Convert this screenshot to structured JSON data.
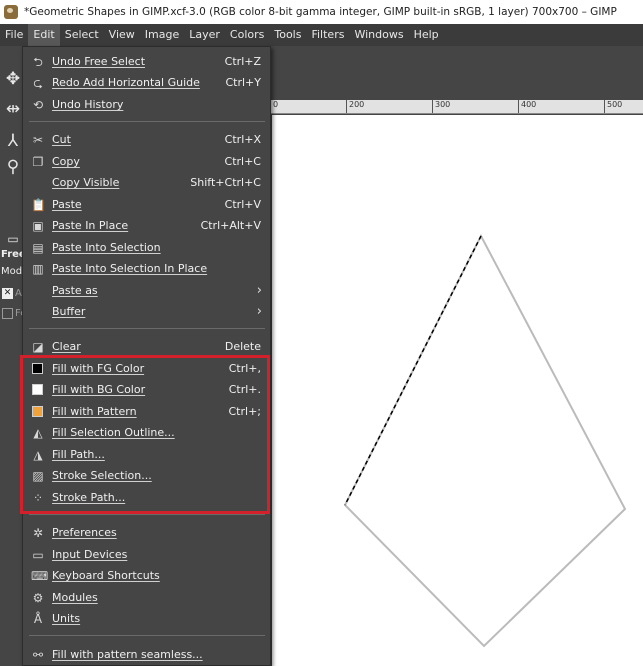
{
  "window": {
    "title": "*Geometric Shapes in GIMP.xcf-3.0 (RGB color 8-bit gamma integer, GIMP built-in sRGB, 1 layer) 700x700 – GIMP"
  },
  "menubar": [
    "File",
    "Edit",
    "Select",
    "View",
    "Image",
    "Layer",
    "Colors",
    "Tools",
    "Filters",
    "Windows",
    "Help"
  ],
  "tool_options": {
    "label_free": "Free",
    "label_mode": "Mode",
    "label_a": "A",
    "label_fe": "Fe"
  },
  "ruler_ticks": [
    "0",
    "200",
    "300",
    "400",
    "500"
  ],
  "edit_menu": {
    "undo": {
      "label": "Undo Free Select",
      "accel": "Ctrl+Z",
      "icon": "undo-icon"
    },
    "redo": {
      "label": "Redo Add Horizontal Guide",
      "accel": "Ctrl+Y",
      "icon": "redo-icon"
    },
    "undo_history": {
      "label": "Undo History",
      "accel": "",
      "icon": "undo-history-icon"
    },
    "cut": {
      "label": "Cut",
      "accel": "Ctrl+X",
      "icon": "scissors-icon"
    },
    "copy": {
      "label": "Copy",
      "accel": "Ctrl+C",
      "icon": "copy-icon"
    },
    "copy_visible": {
      "label": "Copy Visible",
      "accel": "Shift+Ctrl+C"
    },
    "paste": {
      "label": "Paste",
      "accel": "Ctrl+V",
      "icon": "paste-icon"
    },
    "paste_in_place": {
      "label": "Paste In Place",
      "accel": "Ctrl+Alt+V",
      "icon": "paste-in-place-icon"
    },
    "paste_into_selection": {
      "label": "Paste Into Selection",
      "accel": "",
      "icon": "paste-into-selection-icon"
    },
    "paste_into_selection_in_place": {
      "label": "Paste Into Selection In Place",
      "accel": "",
      "icon": "paste-into-selection-in-place-icon"
    },
    "paste_as": {
      "label": "Paste as",
      "accel": ""
    },
    "buffer": {
      "label": "Buffer",
      "accel": ""
    },
    "clear": {
      "label": "Clear",
      "accel": "Delete",
      "icon": "eraser-icon"
    },
    "fill_fg": {
      "label": "Fill with FG Color",
      "accel": "Ctrl+,",
      "color": "#000000"
    },
    "fill_bg": {
      "label": "Fill with BG Color",
      "accel": "Ctrl+.",
      "color": "#ffffff"
    },
    "fill_pattern": {
      "label": "Fill with Pattern",
      "accel": "Ctrl+;",
      "color": "#f2a23a"
    },
    "fill_selection_outline": {
      "label": "Fill Selection Outline...",
      "accel": "",
      "icon": "bucket-fill-icon"
    },
    "fill_path": {
      "label": "Fill Path...",
      "accel": "",
      "icon": "bucket-fill-path-icon"
    },
    "stroke_selection": {
      "label": "Stroke Selection...",
      "accel": "",
      "icon": "stroke-selection-icon"
    },
    "stroke_path": {
      "label": "Stroke Path...",
      "accel": "",
      "icon": "stroke-path-icon"
    },
    "preferences": {
      "label": "Preferences",
      "accel": "",
      "icon": "preferences-icon"
    },
    "input_devices": {
      "label": "Input Devices",
      "accel": "",
      "icon": "input-devices-icon"
    },
    "keyboard_shortcuts": {
      "label": "Keyboard Shortcuts",
      "accel": "",
      "icon": "keyboard-icon"
    },
    "modules": {
      "label": "Modules",
      "accel": "",
      "icon": "modules-icon"
    },
    "units": {
      "label": "Units",
      "accel": "",
      "icon": "units-icon"
    },
    "fill_pattern_seamless": {
      "label": "Fill with pattern seamless...",
      "accel": "",
      "icon": "fill-seamless-icon"
    }
  },
  "colors": {
    "highlight_border": "#d4202b",
    "menu_bg": "#454545",
    "menubar_bg": "#3b3b3b",
    "canvas_bg": "#ffffff"
  }
}
